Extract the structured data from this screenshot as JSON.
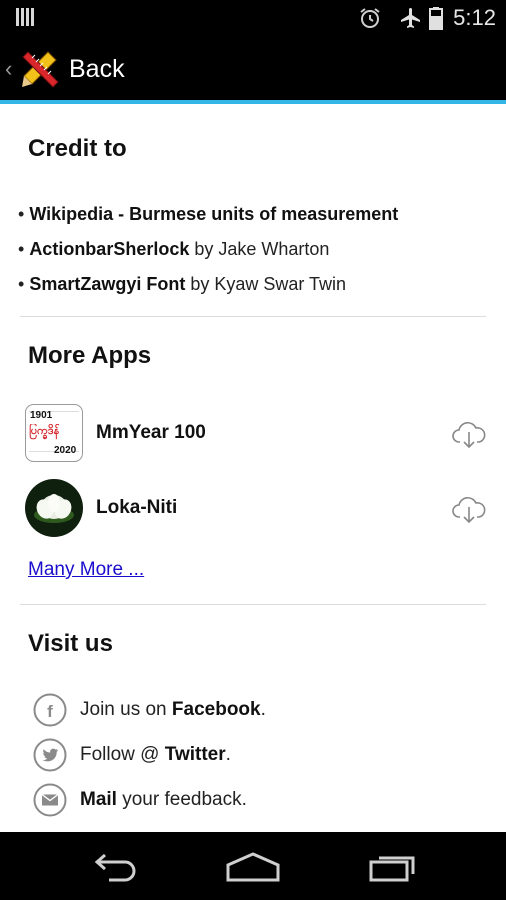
{
  "status": {
    "time": "5:12"
  },
  "actionbar": {
    "back_label": "Back"
  },
  "credit": {
    "title": "Credit to",
    "items": [
      {
        "strong": "Wikipedia - Burmese units of measurement",
        "rest": ""
      },
      {
        "strong": "ActionbarSherlock",
        "rest": " by Jake Wharton"
      },
      {
        "strong": "SmartZawgyi Font",
        "rest": " by Kyaw Swar Twin"
      }
    ]
  },
  "more_apps": {
    "title": "More Apps",
    "apps": [
      {
        "name": "MmYear 100",
        "icon_top": "1901",
        "icon_mid": "ပြက္ခဒိန်",
        "icon_bottom": "2020"
      },
      {
        "name": "Loka-Niti"
      }
    ],
    "more_link": "Many More ..."
  },
  "visit": {
    "title": "Visit us",
    "items": [
      {
        "icon": "facebook-icon",
        "pre": "Join us on ",
        "strong": "Facebook",
        "post": "."
      },
      {
        "icon": "twitter-icon",
        "pre": "Follow @ ",
        "strong": "Twitter",
        "post": "."
      },
      {
        "icon": "mail-icon",
        "pre": "",
        "strong": "Mail",
        "post": " your feedback."
      }
    ]
  },
  "colors": {
    "accent": "#33b5e5",
    "link": "#1a0dcc"
  }
}
